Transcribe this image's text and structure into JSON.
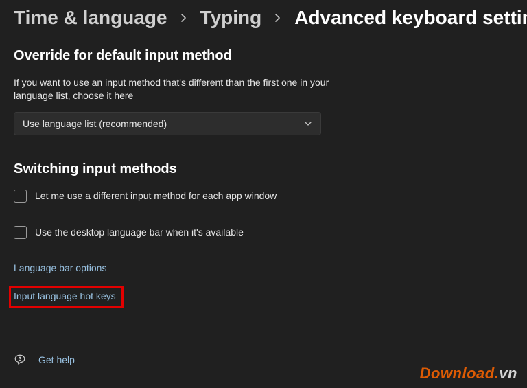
{
  "breadcrumb": {
    "level1": "Time & language",
    "level2": "Typing",
    "level3": "Advanced keyboard settings"
  },
  "section_override": {
    "title": "Override for default input method",
    "description": "If you want to use an input method that's different than the first one in your language list, choose it here",
    "dropdown_value": "Use language list (recommended)"
  },
  "section_switching": {
    "title": "Switching input methods",
    "checkbox1_label": "Let me use a different input method for each app window",
    "checkbox2_label": "Use the desktop language bar when it's available"
  },
  "links": {
    "language_bar_options": "Language bar options",
    "input_language_hotkeys": "Input language hot keys"
  },
  "help": {
    "label": "Get help"
  },
  "watermark": {
    "brand": "Download",
    "dot": ".",
    "tld": "vn"
  }
}
